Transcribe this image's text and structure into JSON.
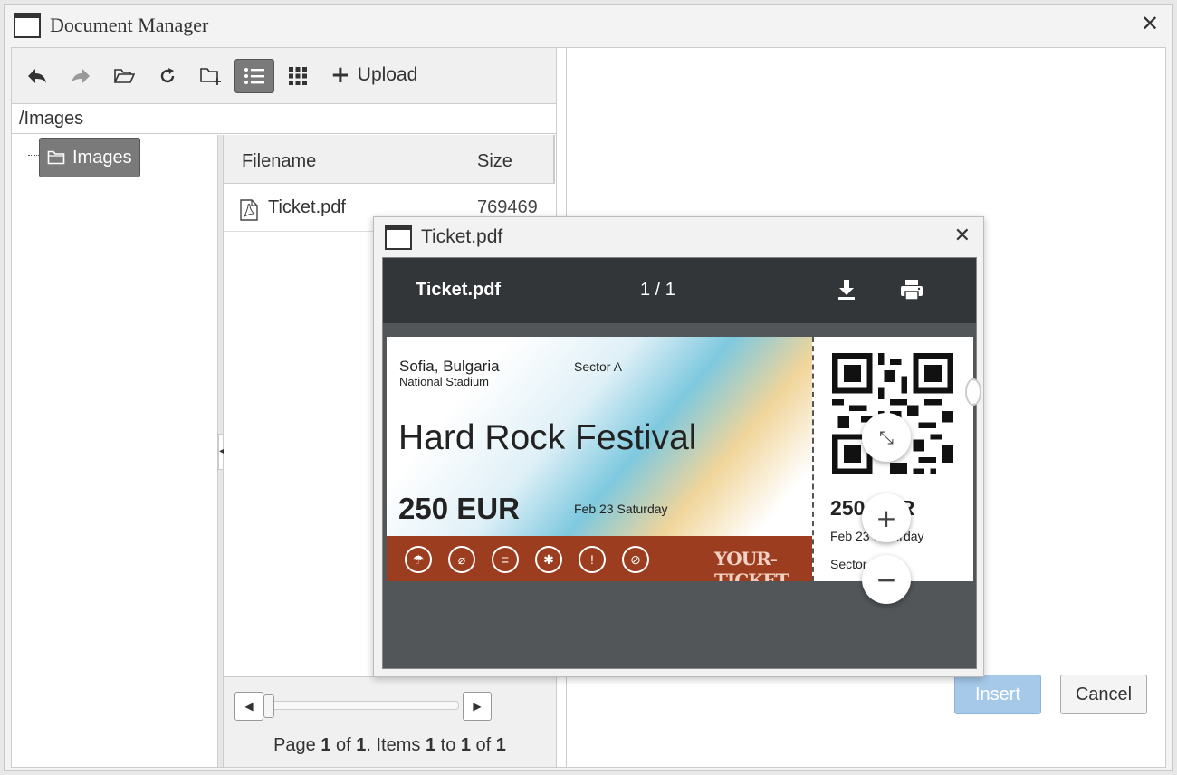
{
  "window": {
    "title": "Document Manager"
  },
  "toolbar": {
    "upload_label": "Upload"
  },
  "path": "/Images",
  "tree": {
    "node_label": "Images"
  },
  "grid": {
    "columns": [
      "Filename",
      "Size"
    ],
    "rows": [
      {
        "filename": "Ticket.pdf",
        "size": "769469"
      }
    ]
  },
  "pager": {
    "p1": "Page ",
    "page": "1",
    "p2": " of ",
    "pages": "1",
    "p3": ". Items ",
    "from": "1",
    "p4": " to ",
    "to": "1",
    "p5": " of ",
    "total": "1"
  },
  "buttons": {
    "insert": "Insert",
    "cancel": "Cancel"
  },
  "preview": {
    "title": "Ticket.pdf",
    "viewer_filename": "Ticket.pdf",
    "page_indicator": "1 / 1"
  },
  "ticket": {
    "city": "Sofia, Bulgaria",
    "venue": "National Stadium",
    "sector": "Sector A",
    "event": "Hard Rock Festival",
    "price": "250 EUR",
    "date": "Feb 23 Saturday",
    "brand": "YOUR-TICKET",
    "stub_price": "250 EUR",
    "stub_date": "Feb 23 Saturday",
    "stub_sector": "Sector A"
  },
  "colors": {
    "accent_selected": "#7a7a7a",
    "viewer_bar": "#323639",
    "ticket_band": "#9c3d1f",
    "insert_button": "#a6c9ea"
  }
}
